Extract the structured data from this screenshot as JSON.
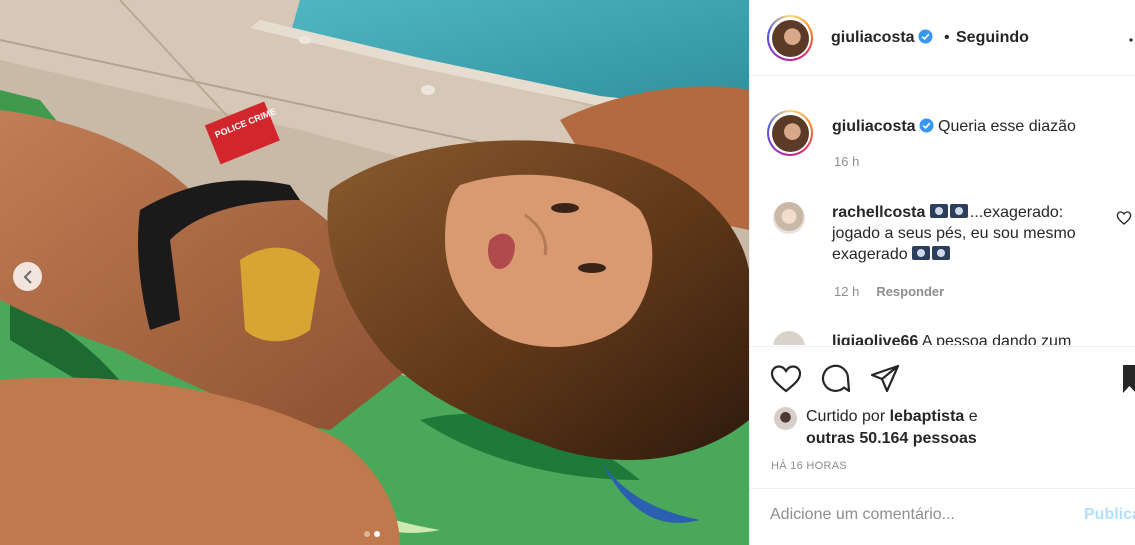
{
  "media": {
    "book_title": "POLICE CRIME",
    "slide_count": 2,
    "active_slide": 2,
    "prev_icon": "chevron-left-icon"
  },
  "post": {
    "author": "giuliacosta",
    "verified_icon": "verified-badge-icon",
    "separator": "•",
    "follow_status": "Seguindo",
    "more_icon": "more-options-icon"
  },
  "caption": {
    "username": "giuliacosta",
    "text": "Queria esse diazão",
    "time": "16 h"
  },
  "comments": [
    {
      "username": "rachellcosta",
      "emoji_icon": "cd-disc-emoji",
      "text": "...exagerado: jogado a seus pés, eu sou mesmo exagerado",
      "time": "12 h",
      "reply_label": "Responder",
      "like_icon": "heart-outline-icon"
    },
    {
      "username": "ligiaolive66",
      "text": "A pessoa dando zum"
    }
  ],
  "actions": {
    "like_icon": "heart-outline-icon",
    "comment_icon": "comment-bubble-icon",
    "share_icon": "paper-plane-icon",
    "save_icon": "bookmark-icon"
  },
  "likes": {
    "prefix": "Curtido por",
    "username": "lebaptista",
    "conjunction": "e",
    "others": "outras 50.164 pessoas"
  },
  "timestamp": "HÁ 16 HORAS",
  "add_comment": {
    "placeholder": "Adicione um comentário...",
    "post_label": "Publicar"
  },
  "colors": {
    "link_disabled": "#b2dffc",
    "secondary_text": "#8e8e8e",
    "verified": "#3897f0"
  }
}
